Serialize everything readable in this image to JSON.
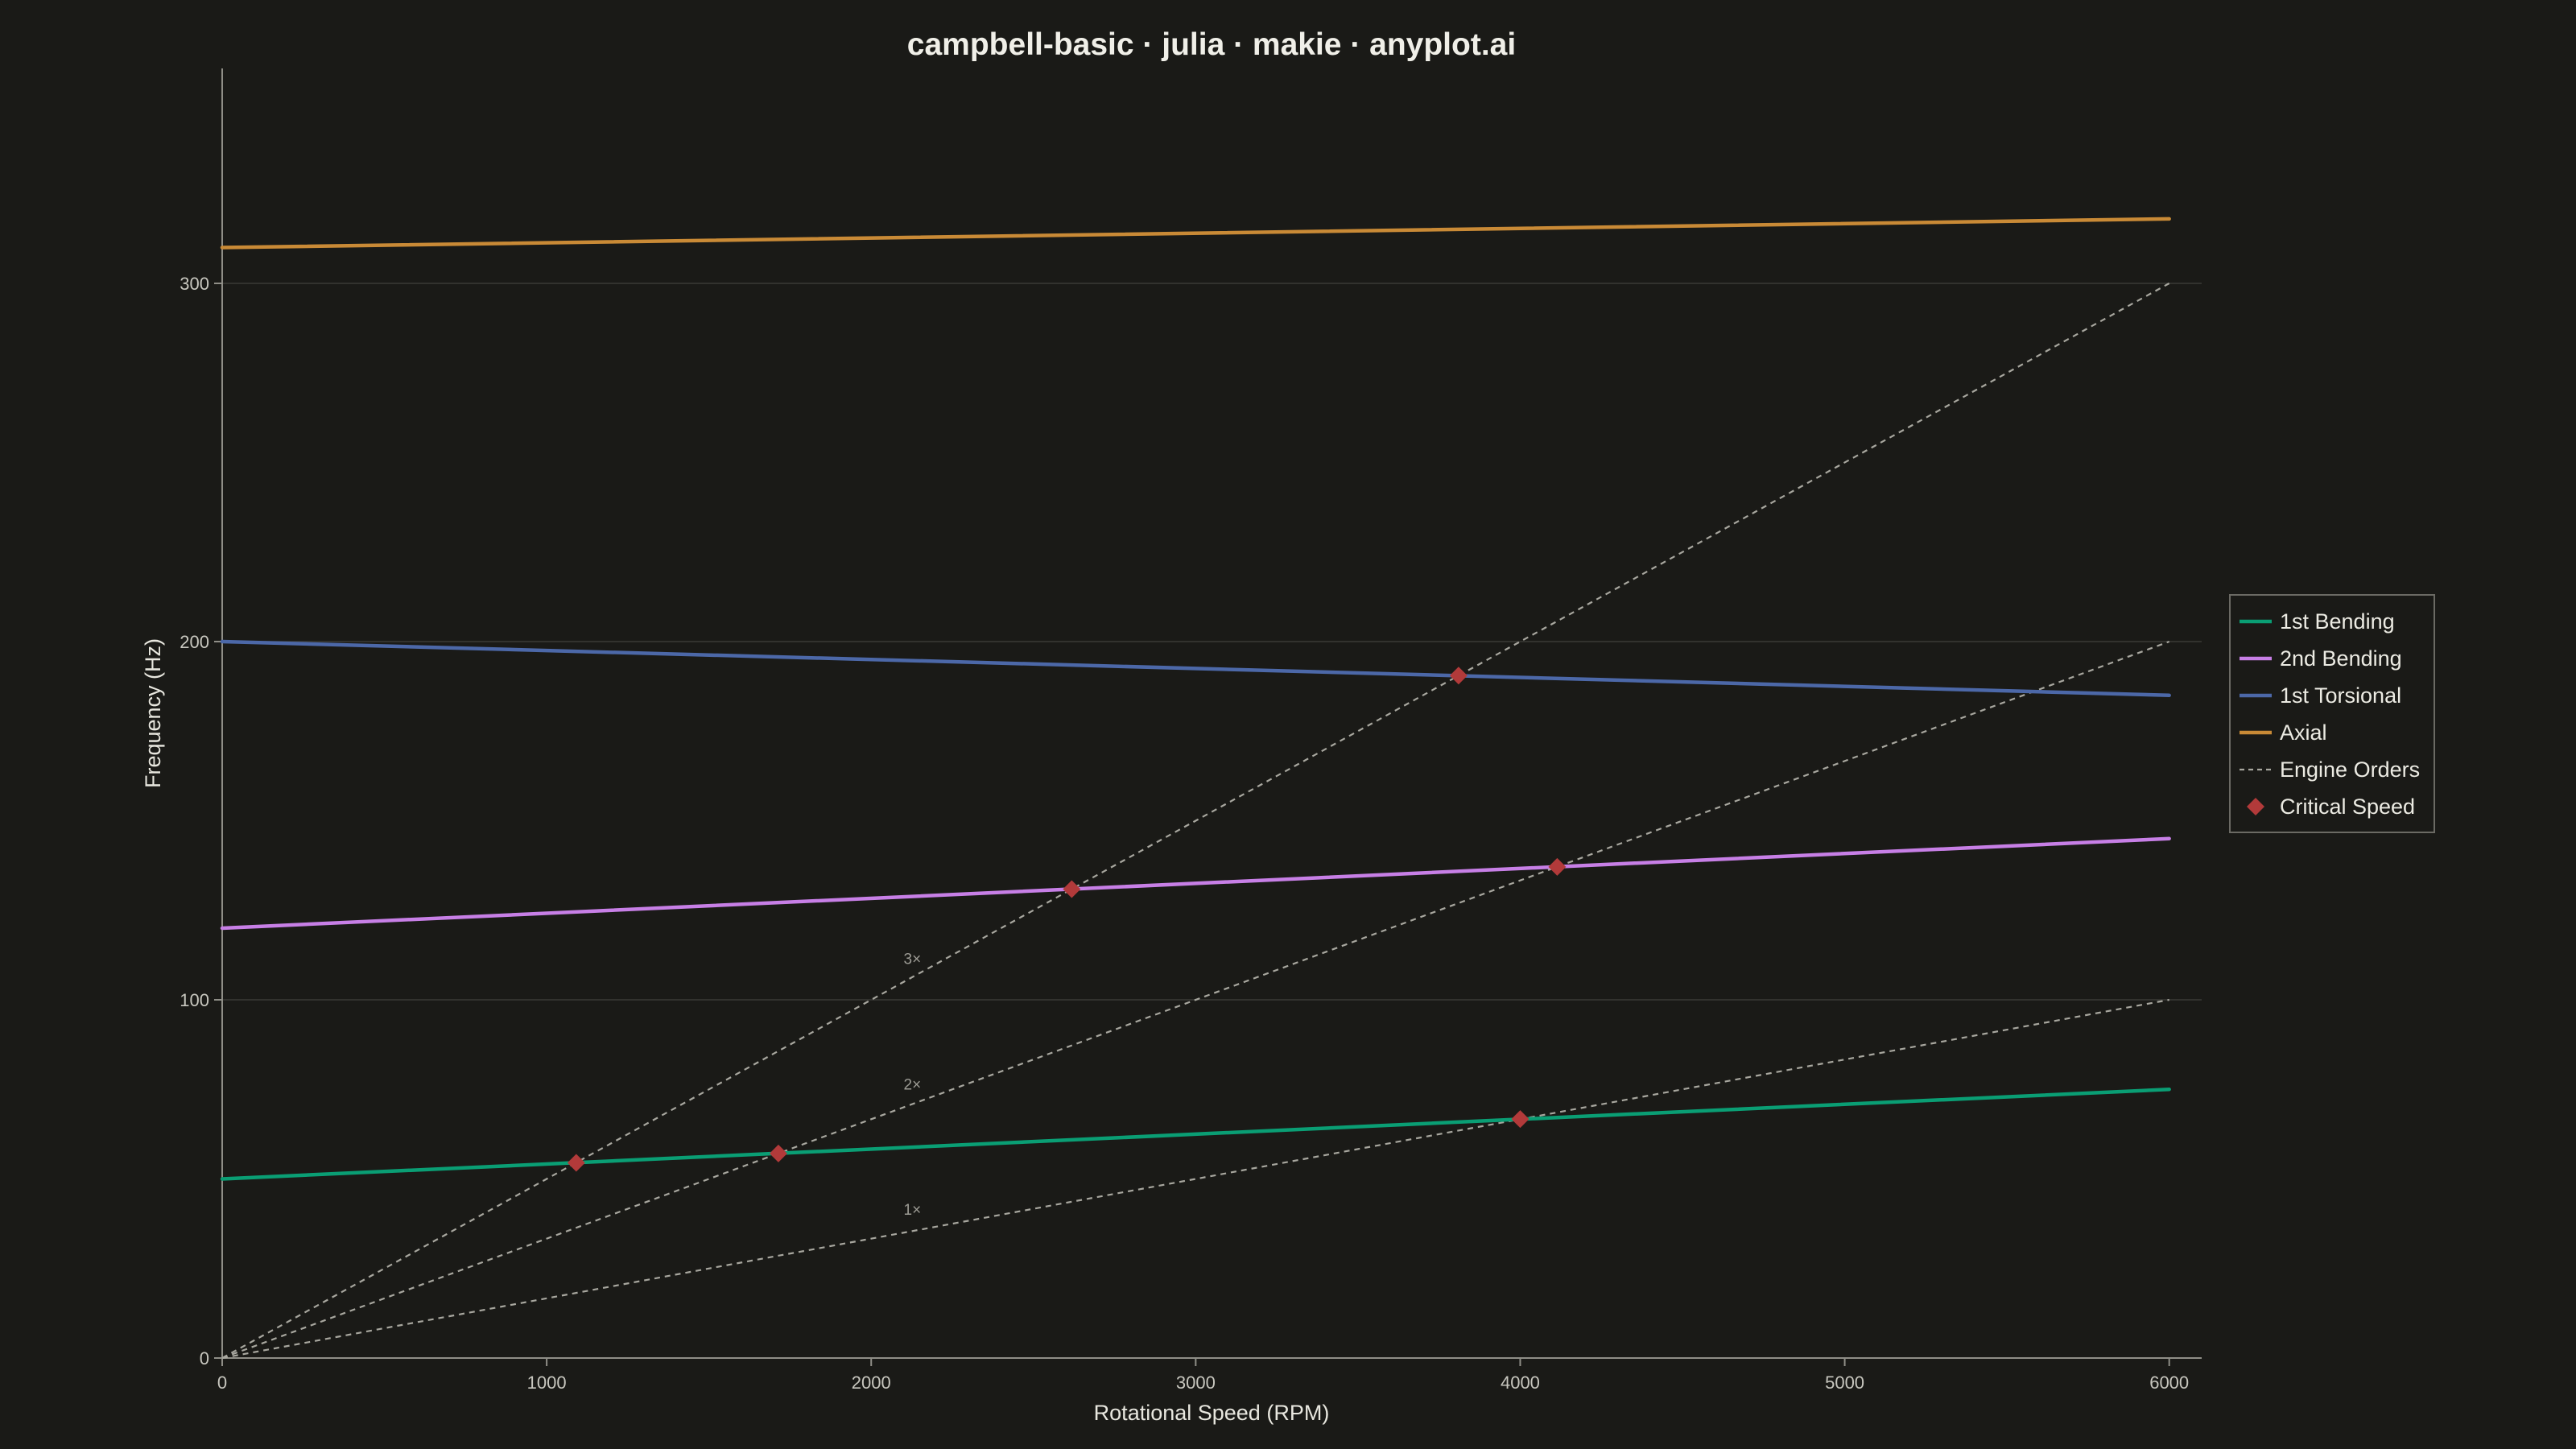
{
  "chart_data": {
    "type": "line",
    "title": "campbell-basic · julia · makie · anyplot.ai",
    "xlabel": "Rotational Speed (RPM)",
    "ylabel": "Frequency (Hz)",
    "xlim": [
      0,
      6100
    ],
    "ylim": [
      0,
      360
    ],
    "xticks": [
      0,
      1000,
      2000,
      3000,
      4000,
      5000,
      6000
    ],
    "xtick_labels": [
      "0",
      "1000",
      "2000",
      "3000",
      "4000",
      "5000",
      "6000"
    ],
    "yticks": [
      0,
      100,
      200,
      300
    ],
    "ytick_labels": [
      "0",
      "100",
      "200",
      "300"
    ],
    "grid": "horizontal",
    "legend_position": "right",
    "background": "#1a1a17",
    "series": [
      {
        "name": "1st Bending",
        "color": "#0a9e74",
        "x": [
          0,
          6000
        ],
        "y": [
          50,
          75
        ]
      },
      {
        "name": "2nd Bending",
        "color": "#c77fe6",
        "x": [
          0,
          6000
        ],
        "y": [
          120,
          145
        ]
      },
      {
        "name": "1st Torsional",
        "color": "#4c68a8",
        "x": [
          0,
          6000
        ],
        "y": [
          200,
          185
        ]
      },
      {
        "name": "Axial",
        "color": "#c98a36",
        "x": [
          0,
          6000
        ],
        "y": [
          310,
          318
        ]
      }
    ],
    "engine_orders": {
      "name": "Engine Orders",
      "color": "#a8a79f",
      "lines": [
        {
          "order": 1,
          "label": "1×",
          "x": [
            0,
            6000
          ],
          "y": [
            0,
            100
          ],
          "label_at": [
            2100,
            40
          ]
        },
        {
          "order": 2,
          "label": "2×",
          "x": [
            0,
            6000
          ],
          "y": [
            0,
            200
          ],
          "label_at": [
            2100,
            75
          ]
        },
        {
          "order": 3,
          "label": "3×",
          "x": [
            0,
            6000
          ],
          "y": [
            0,
            300
          ],
          "label_at": [
            2100,
            110
          ]
        }
      ]
    },
    "critical_speeds": {
      "name": "Critical Speed",
      "color": "#b23a3a",
      "points": [
        {
          "x": 1091,
          "y": 54.5
        },
        {
          "x": 1714,
          "y": 57.1
        },
        {
          "x": 4000,
          "y": 66.7
        },
        {
          "x": 2618,
          "y": 130.9
        },
        {
          "x": 4114,
          "y": 137.1
        },
        {
          "x": 3810,
          "y": 190.5
        }
      ]
    }
  },
  "legend": {
    "items": [
      {
        "label": "1st Bending",
        "kind": "line",
        "color": "#0a9e74"
      },
      {
        "label": "2nd Bending",
        "kind": "line",
        "color": "#c77fe6"
      },
      {
        "label": "1st Torsional",
        "kind": "line",
        "color": "#4c68a8"
      },
      {
        "label": "Axial",
        "kind": "line",
        "color": "#c98a36"
      },
      {
        "label": "Engine Orders",
        "kind": "dashed",
        "color": "#a8a79f"
      },
      {
        "label": "Critical Speed",
        "kind": "diamond",
        "color": "#b23a3a"
      }
    ]
  }
}
